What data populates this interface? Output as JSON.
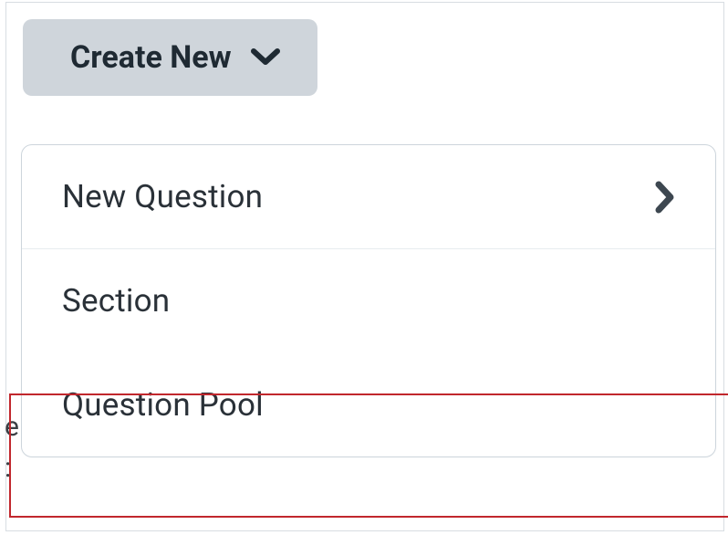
{
  "button": {
    "create_new_label": "Create New"
  },
  "menu": {
    "items": [
      {
        "label": "New Question",
        "has_submenu": true
      },
      {
        "label": "Section",
        "has_submenu": false
      },
      {
        "label": "Question Pool",
        "has_submenu": false
      }
    ]
  },
  "highlight": {
    "target_index": 2
  }
}
